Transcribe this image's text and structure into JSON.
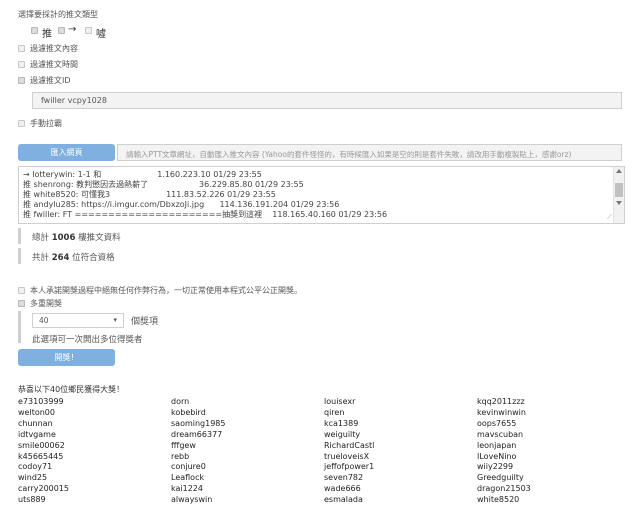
{
  "section_title": "選擇要採計的推文類型",
  "push_types": [
    {
      "label": "推",
      "checked": true
    },
    {
      "label": "→",
      "checked": true
    },
    {
      "label": "噓",
      "checked": false
    }
  ],
  "filter_options": [
    {
      "label": "過濾推文內容",
      "checked": false
    },
    {
      "label": "過濾推文時間",
      "checked": false
    },
    {
      "label": "過濾推文ID",
      "checked": true
    }
  ],
  "id_filter_value": "fwiller vcpy1028",
  "manual_option": {
    "label": "手動拉霸",
    "checked": false
  },
  "import_button": "匯入網頁",
  "url_input": {
    "placeholder": "請輸入PTT文章網址，自動匯入推文內容 (Yahoo的套件怪怪的，有時候匯入如果是空的則是套件失敗，請改用手動複製貼上，感謝orz)"
  },
  "comments": [
    "→ lotterywin: 1-1 和                      1.160.223.10 01/29 23:55",
    "推 shenrong: 教判懲因去過熱薪了                    36.229.85.80 01/29 23:55",
    "推 white8520: 可懂我3                      111.83.52.226 01/29 23:55",
    "推 andylu285: https://i.imgur.com/DbxzoJi.jpg      114.136.191.204 01/29 23:56",
    "推 fwiller: FT ======================抽獎到這裡    118.165.40.160 01/29 23:56"
  ],
  "stats": {
    "total_prefix": "總計",
    "total_count": "1006",
    "total_suffix": "樓推文資料",
    "qualified_prefix": "共計",
    "qualified_count": "264",
    "qualified_suffix": "位符合資格"
  },
  "pledge": {
    "label": "本人承諾開獎過程中絕無任何作弊行為，一切正常使用本程式公平公正開獎。",
    "checked": false
  },
  "multi_prize": {
    "label": "多重開獎",
    "checked": true
  },
  "prize_count": {
    "value": "40",
    "unit": "個獎項"
  },
  "prize_hint": "此選項可一次開出多位得獎者",
  "draw_button": "開獎！",
  "winners_title": "恭喜以下40位鄉民獲得大獎！",
  "winners": [
    [
      "e73103999",
      "dorn",
      "louisexr",
      "kqq2011zzz"
    ],
    [
      "welton00",
      "kobebird",
      "qiren",
      "kevinwinwin"
    ],
    [
      "chunnan",
      "saoming1985",
      "kca1389",
      "oops7655"
    ],
    [
      "idtvgame",
      "dream66377",
      "weiguilty",
      "mavscuban"
    ],
    [
      "smile00062",
      "fffgew",
      "RichardCastl",
      "leonjapan"
    ],
    [
      "k45665445",
      "rebb",
      "trueloveisX",
      "ILoveNino"
    ],
    [
      "codoy71",
      "conjure0",
      "jeffofpower1",
      "wiiy2299"
    ],
    [
      "wind25",
      "Leaflock",
      "seven782",
      "Greedguilty"
    ],
    [
      "carry200015",
      "kai1224",
      "wade666",
      "dragon21503"
    ],
    [
      "uts889",
      "alwayswin",
      "esmalada",
      "white8520"
    ]
  ]
}
